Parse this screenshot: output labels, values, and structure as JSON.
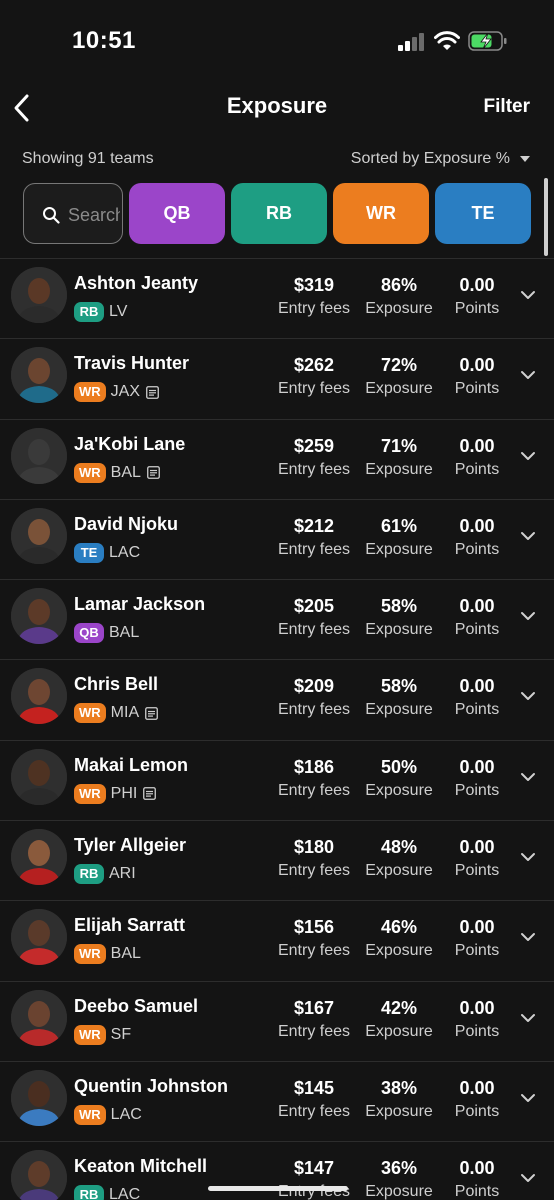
{
  "status": {
    "time": "10:51"
  },
  "header": {
    "title": "Exposure",
    "filter_label": "Filter"
  },
  "summary": {
    "showing": "Showing 91 teams",
    "sort": "Sorted by Exposure %"
  },
  "search": {
    "placeholder": "Search"
  },
  "chips": {
    "qb": "QB",
    "rb": "RB",
    "wr": "WR",
    "te": "TE"
  },
  "colors": {
    "QB": "#9b45c9",
    "RB": "#1e9e83",
    "WR": "#ec7d1f",
    "TE": "#2a7ec2"
  },
  "labels": {
    "fees": "Entry fees",
    "exposure": "Exposure",
    "points": "Points"
  },
  "players": [
    {
      "name": "Ashton Jeanty",
      "pos": "RB",
      "team": "LV",
      "note": false,
      "fees": "$319",
      "exposure": "86%",
      "points": "0.00"
    },
    {
      "name": "Travis Hunter",
      "pos": "WR",
      "team": "JAX",
      "note": true,
      "fees": "$262",
      "exposure": "72%",
      "points": "0.00"
    },
    {
      "name": "Ja'Kobi Lane",
      "pos": "WR",
      "team": "BAL",
      "note": true,
      "fees": "$259",
      "exposure": "71%",
      "points": "0.00"
    },
    {
      "name": "David Njoku",
      "pos": "TE",
      "team": "LAC",
      "note": false,
      "fees": "$212",
      "exposure": "61%",
      "points": "0.00"
    },
    {
      "name": "Lamar Jackson",
      "pos": "QB",
      "team": "BAL",
      "note": false,
      "fees": "$205",
      "exposure": "58%",
      "points": "0.00"
    },
    {
      "name": "Chris Bell",
      "pos": "WR",
      "team": "MIA",
      "note": true,
      "fees": "$209",
      "exposure": "58%",
      "points": "0.00"
    },
    {
      "name": "Makai Lemon",
      "pos": "WR",
      "team": "PHI",
      "note": true,
      "fees": "$186",
      "exposure": "50%",
      "points": "0.00"
    },
    {
      "name": "Tyler Allgeier",
      "pos": "RB",
      "team": "ARI",
      "note": false,
      "fees": "$180",
      "exposure": "48%",
      "points": "0.00"
    },
    {
      "name": "Elijah Sarratt",
      "pos": "WR",
      "team": "BAL",
      "note": false,
      "fees": "$156",
      "exposure": "46%",
      "points": "0.00"
    },
    {
      "name": "Deebo Samuel",
      "pos": "WR",
      "team": "SF",
      "note": false,
      "fees": "$167",
      "exposure": "42%",
      "points": "0.00"
    },
    {
      "name": "Quentin Johnston",
      "pos": "WR",
      "team": "LAC",
      "note": false,
      "fees": "$145",
      "exposure": "38%",
      "points": "0.00"
    },
    {
      "name": "Keaton Mitchell",
      "pos": "RB",
      "team": "LAC",
      "note": false,
      "fees": "$147",
      "exposure": "36%",
      "points": "0.00"
    }
  ]
}
